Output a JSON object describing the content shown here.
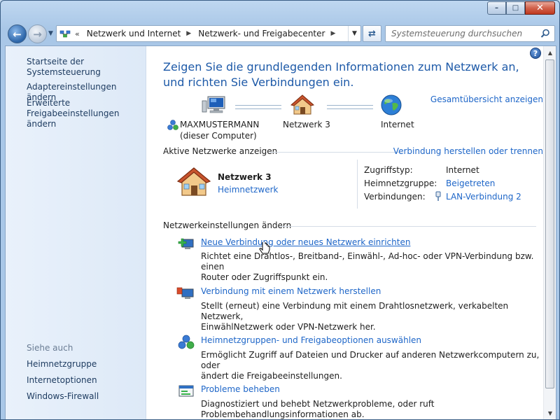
{
  "window": {
    "buttons": {
      "minimize": "–",
      "maximize": "□",
      "close": "✕"
    }
  },
  "address": {
    "chevron": "«",
    "crumbs": [
      "Netzwerk und Internet",
      "Netzwerk- und Freigabecenter"
    ],
    "search_placeholder": "Systemsteuerung durchsuchen"
  },
  "sidebar": {
    "home": "Startseite der Systemsteuerung",
    "adapter": "Adaptereinstellungen ändern",
    "sharing_line1": "Erweiterte",
    "sharing_line2": "Freigabeeinstellungen ändern",
    "see_also": "Siehe auch",
    "links": [
      "Heimnetzgruppe",
      "Internetoptionen",
      "Windows-Firewall"
    ]
  },
  "main": {
    "help": "?",
    "heading": "Zeigen Sie die grundlegenden Informationen zum Netzwerk an, und richten Sie Verbindungen ein.",
    "full_map": "Gesamtübersicht anzeigen",
    "map": {
      "computer_name": "MAXMUSTERMANN",
      "computer_sub": "(dieser Computer)",
      "network": "Netzwerk 3",
      "internet": "Internet"
    },
    "active": {
      "title": "Aktive Netzwerke anzeigen",
      "connect_link": "Verbindung herstellen oder trennen",
      "network_name": "Netzwerk  3",
      "network_type": "Heimnetzwerk",
      "access_label": "Zugriffstyp:",
      "access_value": "Internet",
      "homegroup_label": "Heimnetzgruppe:",
      "homegroup_value": "Beigetreten",
      "connections_label": "Verbindungen:",
      "connections_value": "LAN-Verbindung 2"
    },
    "settings": {
      "title": "Netzwerkeinstellungen ändern",
      "items": [
        {
          "link": "Neue Verbindung oder neues Netzwerk einrichten",
          "desc1": "Richtet eine Drahtlos-, Breitband-, Einwähl-, Ad-hoc- oder VPN-Verbindung bzw. einen",
          "desc2": "Router oder Zugriffspunkt ein."
        },
        {
          "link": "Verbindung mit einem Netzwerk herstellen",
          "desc1": "Stellt (erneut) eine Verbindung mit einem Drahtlosnetzwerk, verkabelten Netzwerk,",
          "desc2": "EinwählNetzwerk oder VPN-Netzwerk her."
        },
        {
          "link": "Heimnetzgruppen- und Freigabeoptionen auswählen",
          "desc1": "Ermöglicht Zugriff auf Dateien und Drucker auf anderen Netzwerkcomputern zu, oder",
          "desc2": "ändert die Freigabeeinstellungen."
        },
        {
          "link": "Probleme beheben",
          "desc1": "Diagnostiziert und behebt Netzwerkprobleme, oder ruft",
          "desc2": "Problembehandlungsinformationen ab."
        }
      ]
    }
  }
}
